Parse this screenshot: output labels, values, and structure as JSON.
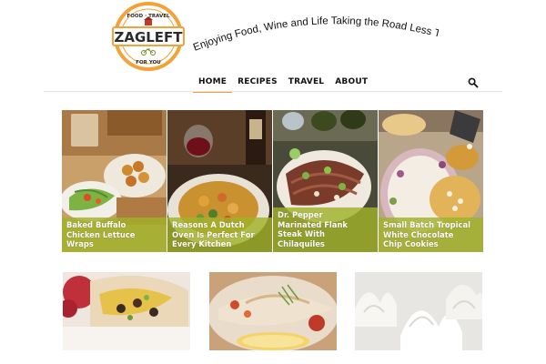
{
  "site": {
    "logo": {
      "brand": "ZAGLEFT",
      "top_text": "FOOD · TRAVEL",
      "bottom_text": "FOR YOU",
      "ring_color": "#f2a23a",
      "brand_color": "#2c2c2c"
    },
    "tagline": "Enjoying Food, Wine and Life Taking the Road Less Traveled"
  },
  "nav": {
    "items": [
      {
        "label": "HOME",
        "active": true
      },
      {
        "label": "RECIPES",
        "active": false
      },
      {
        "label": "TRAVEL",
        "active": false
      },
      {
        "label": "ABOUT",
        "active": false
      }
    ],
    "search_icon": "search-icon",
    "accent_color": "#f2a23a"
  },
  "featured": [
    {
      "title": "Baked Buffalo Chicken Lettuce Wraps",
      "title_lines": [
        "Baked Buffalo",
        "Chicken Lettuce",
        "Wraps"
      ]
    },
    {
      "title": "Reasons A Dutch Oven Is Perfect For Every Kitchen",
      "title_lines": [
        "Reasons A Dutch",
        "Oven Is Perfect For",
        "Every Kitchen"
      ]
    },
    {
      "title": "Dr. Pepper Marinated Flank Steak With Chilaquiles",
      "title_lines": [
        "Dr. Pepper",
        "Marinated Flank",
        "Steak With",
        "Chilaquiles"
      ]
    },
    {
      "title": "Small Batch Tropical White Chocolate Chip Cookies",
      "title_lines": [
        "Small Batch Tropical",
        "White Chocolate",
        "Chip Cookies"
      ]
    }
  ],
  "caption_color": "#a0b228",
  "thumbnails": [
    "breakfast-burrito-photo",
    "baked-fish-photo",
    "whipped-meringue-photo"
  ]
}
